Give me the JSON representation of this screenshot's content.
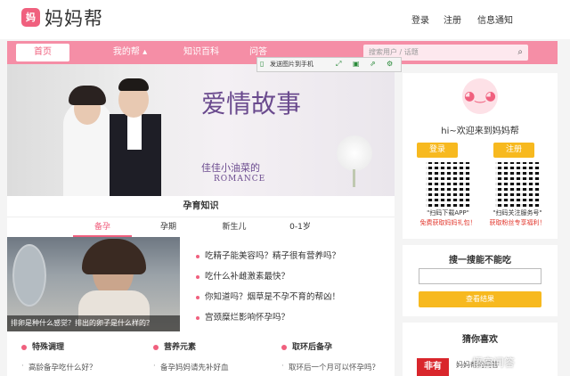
{
  "header": {
    "logo_mark": "妈",
    "logo_text": "妈妈帮",
    "login": "登录",
    "register": "注册",
    "notices": "信息通知"
  },
  "nav": {
    "items": [
      "首页",
      "我的帮 ▴",
      "知识百科",
      "问答"
    ],
    "search_placeholder": "搜索用户 / 话题"
  },
  "toolbar": {
    "label": "发送图片到手机"
  },
  "banner": {
    "title": "爱情故事",
    "subtitle": "佳佳小油菜的",
    "romance": "ROMANCE"
  },
  "section": {
    "title": "孕育知识",
    "tabs": [
      "备孕",
      "孕期",
      "新生儿",
      "0-1岁"
    ]
  },
  "photo_caption": "排卵是种什么感觉？排出的卵子是什么样的？",
  "articles": [
    "吃精子能美容吗？精子很有营养吗？",
    "吃什么补雌激素最快？",
    "你知道吗？烟草是不孕不育的帮凶！",
    "宫颈糜烂影响怀孕吗？"
  ],
  "categories": [
    {
      "title": "特殊调理",
      "item": "高龄备孕吃什么好？"
    },
    {
      "title": "营养元素",
      "item": "备孕妈妈请先补好血"
    },
    {
      "title": "取环后备孕",
      "item": "取环后一个月可以怀孕吗？"
    }
  ],
  "sidebar": {
    "avatar": "◕‿◕",
    "welcome": "hi~欢迎来到妈妈帮",
    "login_btn": "登录",
    "register_btn": "注册",
    "qr1_cap": "\"扫码下载APP\"",
    "qr1_sub": "免费获取妈妈礼包！",
    "qr2_cap": "\"扫码关注服务号\"",
    "qr2_sub": "获取粉丝专享福利！"
  },
  "search_box": {
    "title": "搜一搜能不能吃",
    "button": "查看结果"
  },
  "recommend": {
    "title": "猜你喜欢",
    "thumb": "非有",
    "text": "妈妈帮的问答"
  },
  "watermark": "悟空问答"
}
